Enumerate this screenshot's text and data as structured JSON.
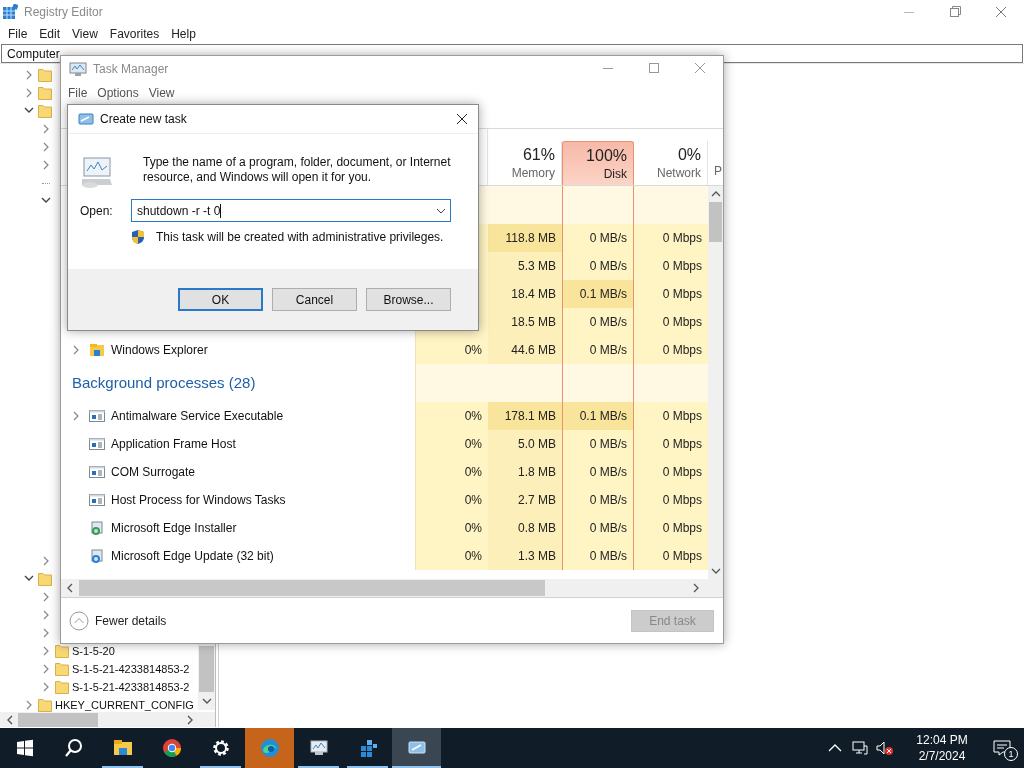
{
  "registry_editor": {
    "title": "Registry Editor",
    "menu": [
      "File",
      "Edit",
      "View",
      "Favorites",
      "Help"
    ],
    "address": "Computer",
    "tree": [
      {
        "expandable": true,
        "expanded": false
      },
      {
        "expandable": true,
        "expanded": false
      },
      {
        "expandable": true,
        "expanded": true,
        "children": [
          {
            "expandable": true,
            "expanded": false
          },
          {
            "expandable": true,
            "expanded": false
          },
          {
            "expandable": true,
            "expanded": false
          },
          {
            "expandable": false,
            "expanded": false
          },
          {
            "expandable": true,
            "expanded": true
          },
          {
            "expandable": true,
            "expanded": false
          }
        ]
      },
      {
        "expandable": true,
        "expanded": true,
        "children": [
          {
            "expandable": true,
            "expanded": false
          },
          {
            "expandable": true,
            "expanded": false
          },
          {
            "expandable": true,
            "expanded": false
          },
          {
            "label": "S-1-5-20",
            "expandable": true,
            "expanded": false
          },
          {
            "label": "S-1-5-21-4233814853-2",
            "expandable": true,
            "expanded": false
          },
          {
            "label": "S-1-5-21-4233814853-2",
            "expandable": true,
            "expanded": false
          }
        ]
      },
      {
        "label": "HKEY_CURRENT_CONFIG",
        "expandable": true,
        "expanded": false
      }
    ]
  },
  "task_manager": {
    "title": "Task Manager",
    "menu": [
      "File",
      "Options",
      "View"
    ],
    "columns": [
      {
        "percent": "61%",
        "label": "Memory",
        "alert": false
      },
      {
        "percent": "100%",
        "label": "Disk",
        "alert": true
      },
      {
        "percent": "0%",
        "label": "Network",
        "alert": false
      }
    ],
    "cut_column_heading": "P",
    "groups": [
      {
        "rows": [
          {
            "expandable": false,
            "memory": "118.8 MB",
            "disk": "0 MB/s",
            "network": "0 Mbps",
            "memory_hot": true,
            "disk_hot": false
          },
          {
            "expandable": false,
            "memory": "5.3 MB",
            "disk": "0 MB/s",
            "network": "0 Mbps",
            "memory_hot": false,
            "disk_hot": false
          },
          {
            "expandable": false,
            "memory": "18.4 MB",
            "disk": "0.1 MB/s",
            "network": "0 Mbps",
            "memory_hot": false,
            "disk_hot": true
          },
          {
            "expandable": false,
            "memory": "18.5 MB",
            "disk": "0 MB/s",
            "network": "0 Mbps",
            "memory_hot": false,
            "disk_hot": false
          },
          {
            "name": "Windows Explorer",
            "kind": "explorer",
            "expandable": true,
            "cpu": "0%",
            "memory": "44.6 MB",
            "disk": "0 MB/s",
            "network": "0 Mbps",
            "memory_hot": false,
            "disk_hot": false
          }
        ]
      },
      {
        "title": "Background processes (28)",
        "rows": [
          {
            "name": "Antimalware Service Executable",
            "kind": "app",
            "expandable": true,
            "cpu": "0%",
            "memory": "178.1 MB",
            "disk": "0.1 MB/s",
            "network": "0 Mbps",
            "memory_hot": true,
            "disk_hot": true
          },
          {
            "name": "Application Frame Host",
            "kind": "app",
            "expandable": false,
            "cpu": "0%",
            "memory": "5.0 MB",
            "disk": "0 MB/s",
            "network": "0 Mbps",
            "memory_hot": false,
            "disk_hot": false
          },
          {
            "name": "COM Surrogate",
            "kind": "app",
            "expandable": false,
            "cpu": "0%",
            "memory": "1.8 MB",
            "disk": "0 MB/s",
            "network": "0 Mbps",
            "memory_hot": false,
            "disk_hot": false
          },
          {
            "name": "Host Process for Windows Tasks",
            "kind": "app",
            "expandable": false,
            "cpu": "0%",
            "memory": "2.7 MB",
            "disk": "0 MB/s",
            "network": "0 Mbps",
            "memory_hot": false,
            "disk_hot": false
          },
          {
            "name": "Microsoft Edge Installer",
            "kind": "installer",
            "expandable": false,
            "cpu": "0%",
            "memory": "0.8 MB",
            "disk": "0 MB/s",
            "network": "0 Mbps",
            "memory_hot": false,
            "disk_hot": false
          },
          {
            "name": "Microsoft Edge Update (32 bit)",
            "kind": "updater",
            "expandable": false,
            "cpu": "0%",
            "memory": "1.3 MB",
            "disk": "0 MB/s",
            "network": "0 Mbps",
            "memory_hot": false,
            "disk_hot": false
          }
        ]
      }
    ],
    "footer": {
      "toggle": "Fewer details",
      "end_task": {
        "label": "End task",
        "disabled": true
      }
    }
  },
  "dialog": {
    "title": "Create new task",
    "message": "Type the name of a program, folder, document, or Internet resource, and Windows will open it for you.",
    "open_label": "Open:",
    "open_value": "shutdown -r -t 0",
    "note": "This task will be created with administrative privileges.",
    "buttons": [
      {
        "label": "OK",
        "default": true
      },
      {
        "label": "Cancel",
        "default": false
      },
      {
        "label": "Browse...",
        "default": false
      }
    ]
  },
  "taskbar": {
    "apps": [
      {
        "kind": "start",
        "running": false,
        "selected": false,
        "flashing": false
      },
      {
        "kind": "search",
        "running": false,
        "selected": false,
        "flashing": false
      },
      {
        "kind": "explorer",
        "running": true,
        "selected": false,
        "flashing": false
      },
      {
        "kind": "chrome",
        "running": false,
        "selected": false,
        "flashing": false
      },
      {
        "kind": "settings",
        "running": true,
        "selected": false,
        "flashing": false
      },
      {
        "kind": "edge",
        "running": false,
        "selected": false,
        "flashing": true
      },
      {
        "kind": "taskmgr",
        "running": true,
        "selected": false,
        "flashing": false
      },
      {
        "kind": "regedit",
        "running": true,
        "selected": false,
        "flashing": false
      },
      {
        "kind": "run",
        "running": true,
        "selected": true,
        "flashing": false
      }
    ],
    "time": "12:04 PM",
    "date": "2/7/2024",
    "notifications": "1"
  }
}
